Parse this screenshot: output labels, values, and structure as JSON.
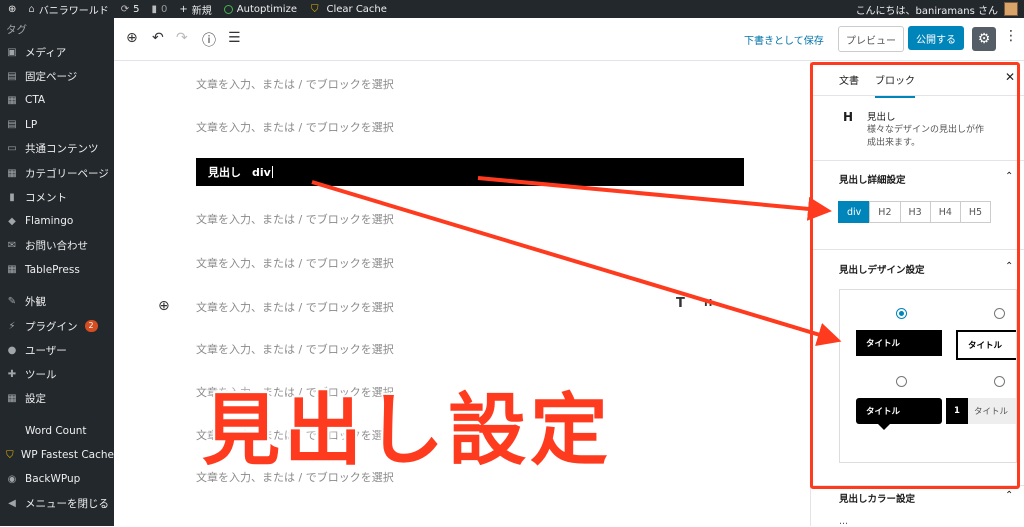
{
  "admin_bar": {
    "site_name": "バニラワールド",
    "updates_count": "5",
    "comments_count": "0",
    "new_label": "新規",
    "autoptimize_label": "Autoptimize",
    "clear_cache_label": "Clear Cache",
    "greeting": "こんにちは、baniramans さん"
  },
  "sidebar": {
    "top_label": "タグ",
    "items": [
      {
        "label": "メディア",
        "icon": "media-icon"
      },
      {
        "label": "固定ページ",
        "icon": "page-icon"
      },
      {
        "label": "CTA",
        "icon": "cta-icon"
      },
      {
        "label": "LP",
        "icon": "lp-icon"
      },
      {
        "label": "共通コンテンツ",
        "icon": "content-icon"
      },
      {
        "label": "カテゴリーページ",
        "icon": "category-icon"
      },
      {
        "label": "コメント",
        "icon": "comment-icon"
      },
      {
        "label": "Flamingo",
        "icon": "flamingo-icon"
      },
      {
        "label": "お問い合わせ",
        "icon": "mail-icon"
      },
      {
        "label": "TablePress",
        "icon": "table-icon"
      },
      {
        "label": "外観",
        "icon": "appearance-icon"
      },
      {
        "label": "プラグイン",
        "icon": "plugin-icon"
      },
      {
        "label": "ユーザー",
        "icon": "user-icon"
      },
      {
        "label": "ツール",
        "icon": "tools-icon"
      },
      {
        "label": "設定",
        "icon": "settings-icon"
      },
      {
        "label": "Word Count",
        "icon": "word-count-icon"
      },
      {
        "label": "WP Fastest Cache",
        "icon": "cache-icon"
      },
      {
        "label": "BackWPup",
        "icon": "backup-icon"
      },
      {
        "label": "メニューを閉じる",
        "icon": "collapse-icon"
      }
    ],
    "plugin_badge": "2"
  },
  "toolbar": {
    "save_draft_label": "下書きとして保存",
    "preview_label": "プレビュー",
    "publish_label": "公開する"
  },
  "editor": {
    "placeholder": "文章を入力、または / でブロックを選択",
    "heading_text": "見出し　div",
    "format_t": "T",
    "format_h": "H"
  },
  "overlay_title": "見出し設定",
  "panel": {
    "tab_document": "文書",
    "tab_block": "ブロック",
    "block_icon": "H",
    "block_title": "見出し",
    "block_desc": "様々なデザインの見出しが作成出来ます。",
    "detail_title": "見出し詳細設定",
    "levels": [
      "div",
      "H2",
      "H3",
      "H4",
      "H5"
    ],
    "selected_level": "div",
    "design_title": "見出しデザイン設定",
    "design_option_label": "タイトル",
    "design_number": "1",
    "color_title": "見出しカラー設定",
    "color_sub": "...",
    "accent_color": "#ff3b1f",
    "primary_color": "#0085ba"
  }
}
